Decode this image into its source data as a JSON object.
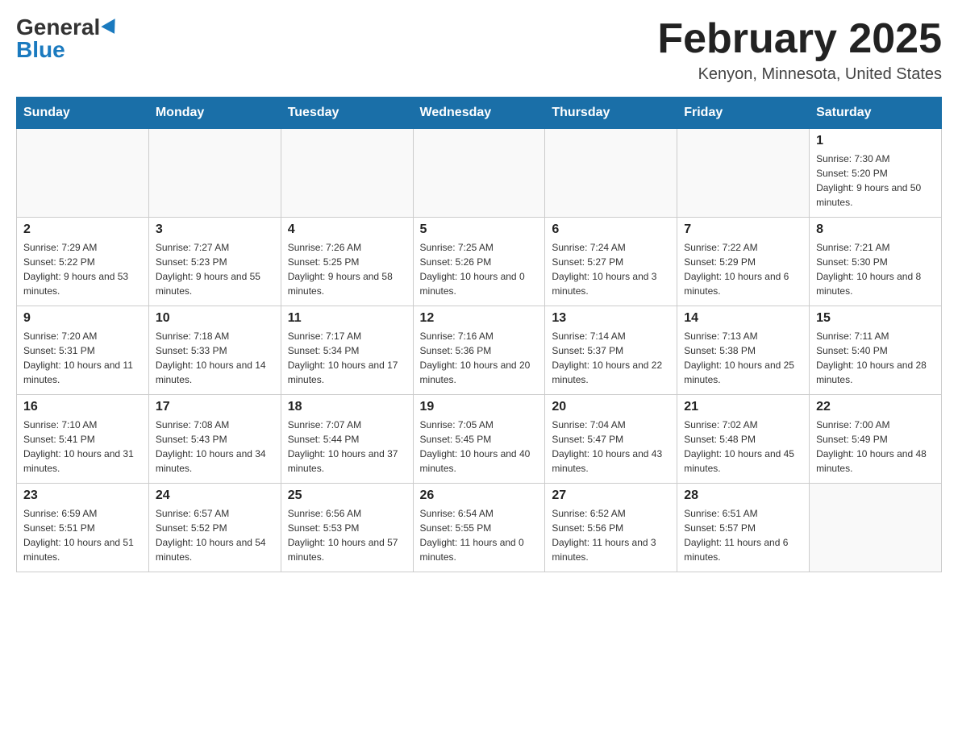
{
  "header": {
    "logo_general": "General",
    "logo_blue": "Blue",
    "month_title": "February 2025",
    "location": "Kenyon, Minnesota, United States"
  },
  "days_of_week": [
    "Sunday",
    "Monday",
    "Tuesday",
    "Wednesday",
    "Thursday",
    "Friday",
    "Saturday"
  ],
  "weeks": [
    [
      {
        "day": "",
        "info": ""
      },
      {
        "day": "",
        "info": ""
      },
      {
        "day": "",
        "info": ""
      },
      {
        "day": "",
        "info": ""
      },
      {
        "day": "",
        "info": ""
      },
      {
        "day": "",
        "info": ""
      },
      {
        "day": "1",
        "info": "Sunrise: 7:30 AM\nSunset: 5:20 PM\nDaylight: 9 hours and 50 minutes."
      }
    ],
    [
      {
        "day": "2",
        "info": "Sunrise: 7:29 AM\nSunset: 5:22 PM\nDaylight: 9 hours and 53 minutes."
      },
      {
        "day": "3",
        "info": "Sunrise: 7:27 AM\nSunset: 5:23 PM\nDaylight: 9 hours and 55 minutes."
      },
      {
        "day": "4",
        "info": "Sunrise: 7:26 AM\nSunset: 5:25 PM\nDaylight: 9 hours and 58 minutes."
      },
      {
        "day": "5",
        "info": "Sunrise: 7:25 AM\nSunset: 5:26 PM\nDaylight: 10 hours and 0 minutes."
      },
      {
        "day": "6",
        "info": "Sunrise: 7:24 AM\nSunset: 5:27 PM\nDaylight: 10 hours and 3 minutes."
      },
      {
        "day": "7",
        "info": "Sunrise: 7:22 AM\nSunset: 5:29 PM\nDaylight: 10 hours and 6 minutes."
      },
      {
        "day": "8",
        "info": "Sunrise: 7:21 AM\nSunset: 5:30 PM\nDaylight: 10 hours and 8 minutes."
      }
    ],
    [
      {
        "day": "9",
        "info": "Sunrise: 7:20 AM\nSunset: 5:31 PM\nDaylight: 10 hours and 11 minutes."
      },
      {
        "day": "10",
        "info": "Sunrise: 7:18 AM\nSunset: 5:33 PM\nDaylight: 10 hours and 14 minutes."
      },
      {
        "day": "11",
        "info": "Sunrise: 7:17 AM\nSunset: 5:34 PM\nDaylight: 10 hours and 17 minutes."
      },
      {
        "day": "12",
        "info": "Sunrise: 7:16 AM\nSunset: 5:36 PM\nDaylight: 10 hours and 20 minutes."
      },
      {
        "day": "13",
        "info": "Sunrise: 7:14 AM\nSunset: 5:37 PM\nDaylight: 10 hours and 22 minutes."
      },
      {
        "day": "14",
        "info": "Sunrise: 7:13 AM\nSunset: 5:38 PM\nDaylight: 10 hours and 25 minutes."
      },
      {
        "day": "15",
        "info": "Sunrise: 7:11 AM\nSunset: 5:40 PM\nDaylight: 10 hours and 28 minutes."
      }
    ],
    [
      {
        "day": "16",
        "info": "Sunrise: 7:10 AM\nSunset: 5:41 PM\nDaylight: 10 hours and 31 minutes."
      },
      {
        "day": "17",
        "info": "Sunrise: 7:08 AM\nSunset: 5:43 PM\nDaylight: 10 hours and 34 minutes."
      },
      {
        "day": "18",
        "info": "Sunrise: 7:07 AM\nSunset: 5:44 PM\nDaylight: 10 hours and 37 minutes."
      },
      {
        "day": "19",
        "info": "Sunrise: 7:05 AM\nSunset: 5:45 PM\nDaylight: 10 hours and 40 minutes."
      },
      {
        "day": "20",
        "info": "Sunrise: 7:04 AM\nSunset: 5:47 PM\nDaylight: 10 hours and 43 minutes."
      },
      {
        "day": "21",
        "info": "Sunrise: 7:02 AM\nSunset: 5:48 PM\nDaylight: 10 hours and 45 minutes."
      },
      {
        "day": "22",
        "info": "Sunrise: 7:00 AM\nSunset: 5:49 PM\nDaylight: 10 hours and 48 minutes."
      }
    ],
    [
      {
        "day": "23",
        "info": "Sunrise: 6:59 AM\nSunset: 5:51 PM\nDaylight: 10 hours and 51 minutes."
      },
      {
        "day": "24",
        "info": "Sunrise: 6:57 AM\nSunset: 5:52 PM\nDaylight: 10 hours and 54 minutes."
      },
      {
        "day": "25",
        "info": "Sunrise: 6:56 AM\nSunset: 5:53 PM\nDaylight: 10 hours and 57 minutes."
      },
      {
        "day": "26",
        "info": "Sunrise: 6:54 AM\nSunset: 5:55 PM\nDaylight: 11 hours and 0 minutes."
      },
      {
        "day": "27",
        "info": "Sunrise: 6:52 AM\nSunset: 5:56 PM\nDaylight: 11 hours and 3 minutes."
      },
      {
        "day": "28",
        "info": "Sunrise: 6:51 AM\nSunset: 5:57 PM\nDaylight: 11 hours and 6 minutes."
      },
      {
        "day": "",
        "info": ""
      }
    ]
  ]
}
